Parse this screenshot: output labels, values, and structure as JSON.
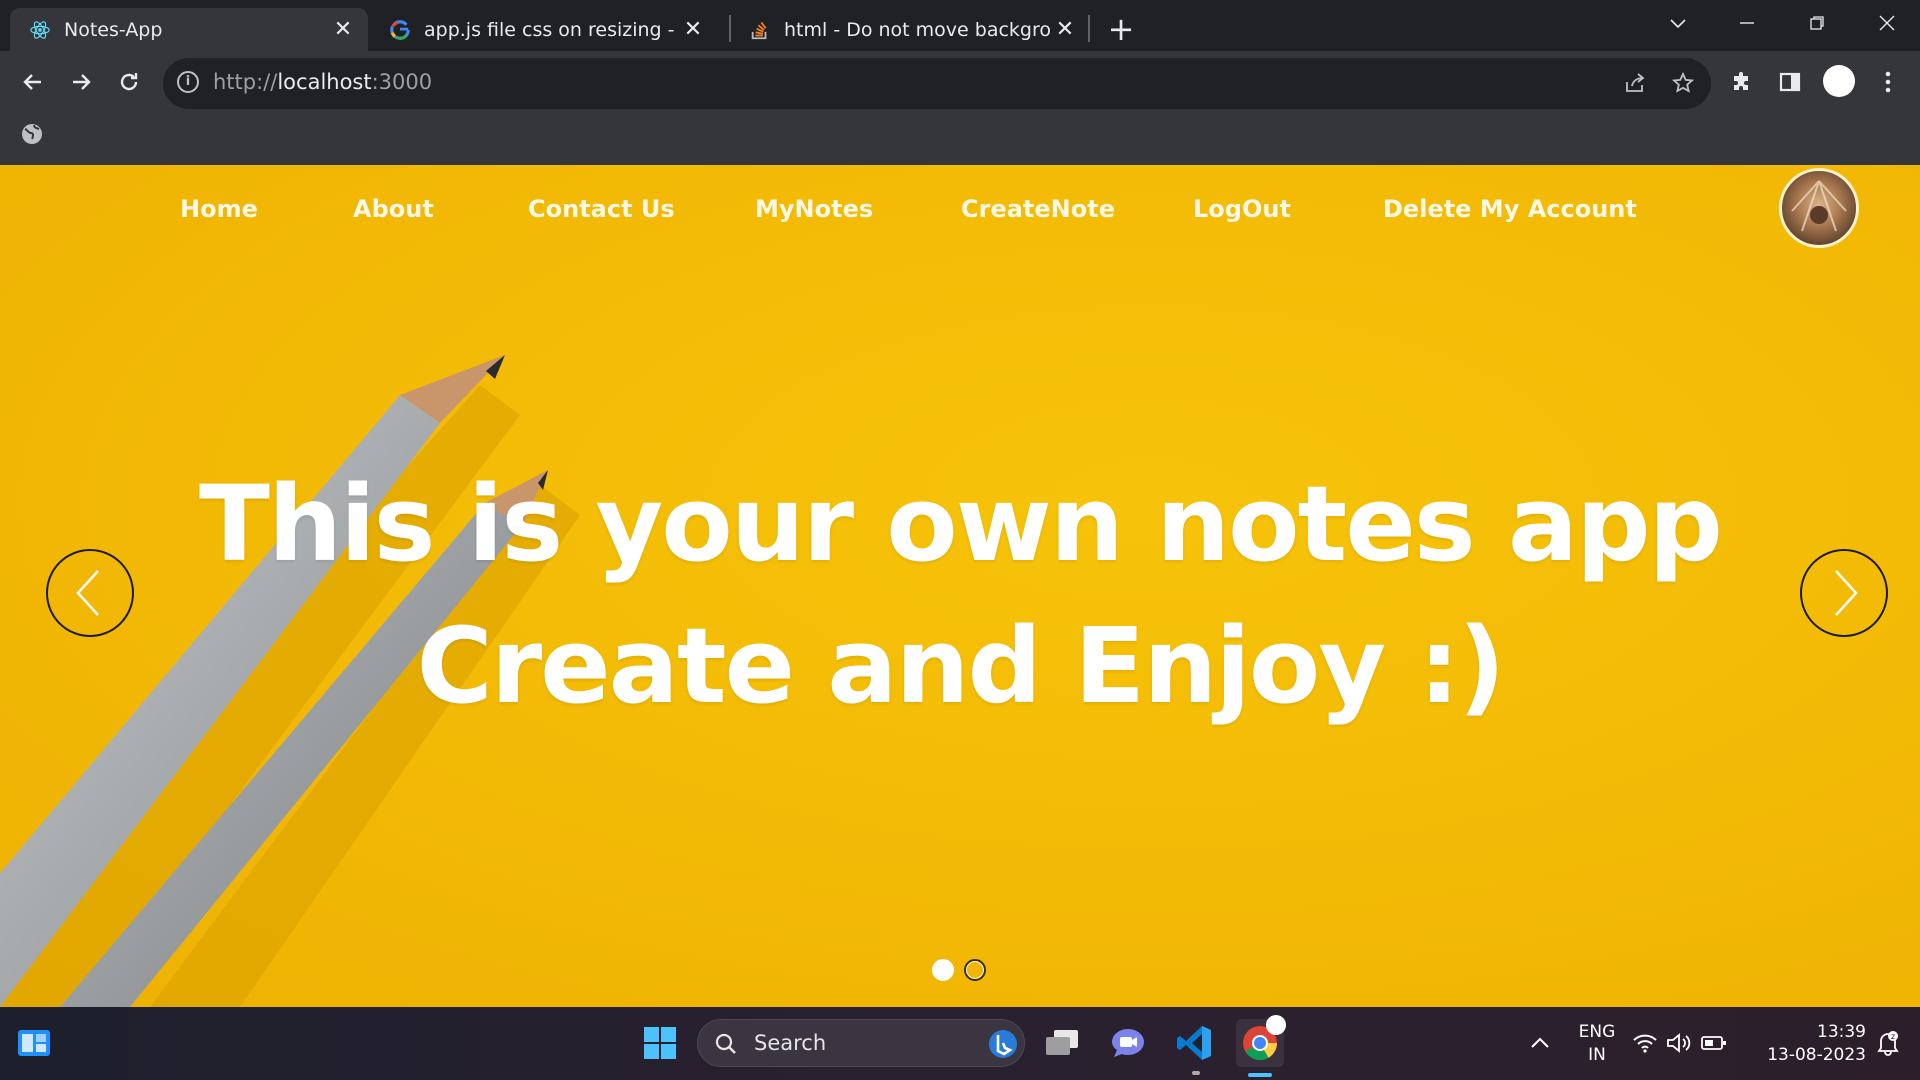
{
  "browser": {
    "tabs": [
      {
        "title": "Notes-App",
        "icon": "react-icon",
        "active": true
      },
      {
        "title": "app.js file css on resizing - Googl",
        "icon": "google-icon",
        "active": false
      },
      {
        "title": "html - Do not move background",
        "icon": "stackoverflow-icon",
        "active": false
      }
    ],
    "url_scheme": "http://",
    "url_host": "localhost",
    "url_port": ":3000"
  },
  "nav": {
    "links": [
      "Home",
      "About",
      "Contact Us",
      "MyNotes",
      "CreateNote",
      "LogOut",
      "Delete My Account"
    ]
  },
  "hero": {
    "line1": "This is your own notes app",
    "line2": "Create and Enjoy :)",
    "slides": 2,
    "active_slide": 1
  },
  "taskbar": {
    "search_placeholder": "Search",
    "lang_top": "ENG",
    "lang_bottom": "IN",
    "time": "13:39",
    "date": "13-08-2023"
  },
  "colors": {
    "hero_background": "#f3bb06",
    "chrome_dark": "#202124",
    "chrome_toolbar": "#35363a"
  }
}
